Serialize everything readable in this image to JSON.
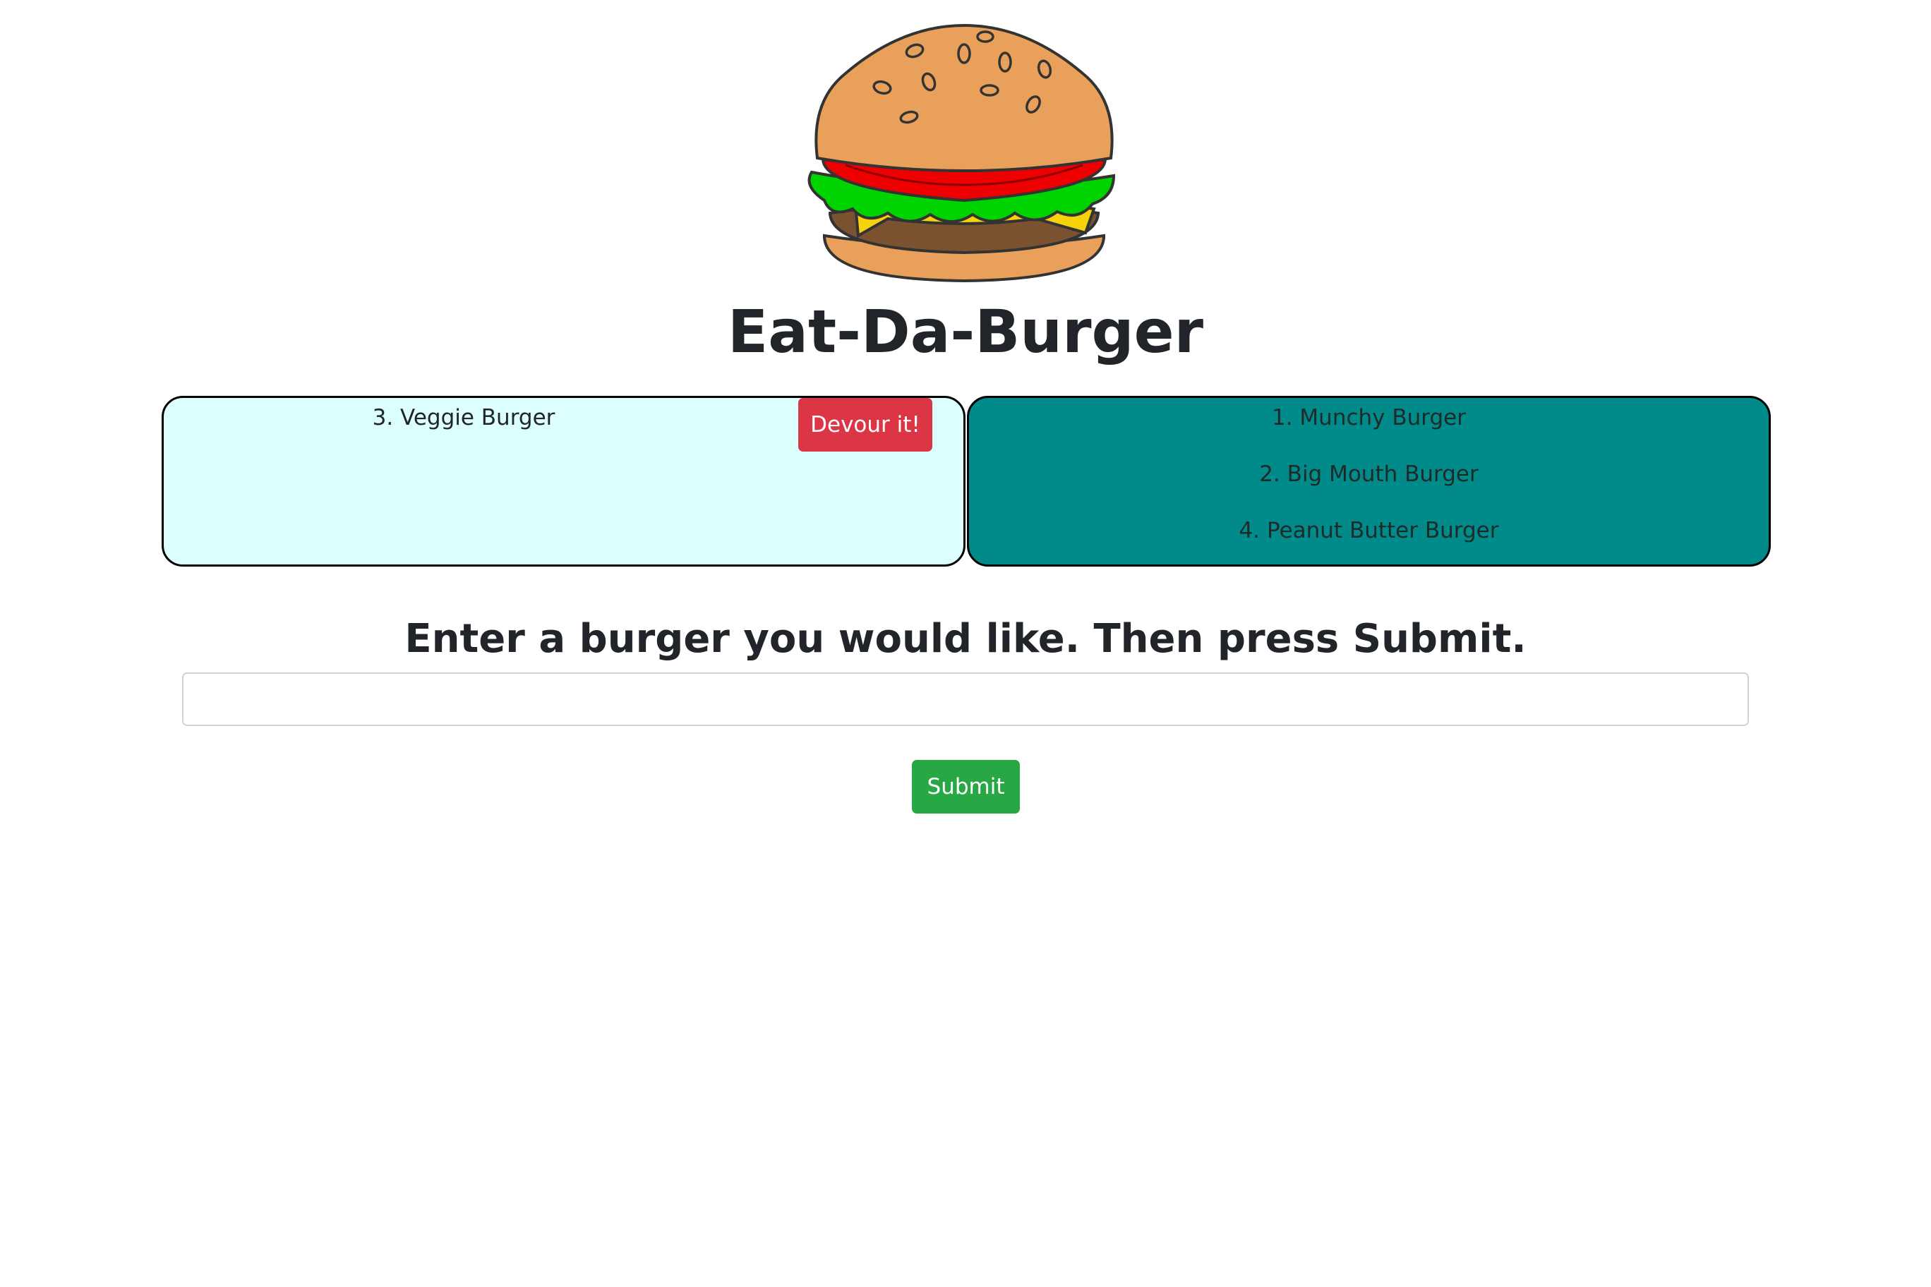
{
  "header": {
    "logo_icon": "hamburger-icon",
    "title": "Eat-Da-Burger"
  },
  "undevoured": {
    "items": [
      {
        "label": "3. Veggie Burger",
        "button_label": "Devour it!"
      }
    ],
    "background": "#dcfffe"
  },
  "devoured": {
    "items": [
      {
        "label": "1. Munchy Burger"
      },
      {
        "label": "2. Big Mouth Burger"
      },
      {
        "label": "4. Peanut Butter Burger"
      }
    ],
    "background": "#008b8a"
  },
  "form": {
    "prompt": "Enter a burger you would like. Then press Submit.",
    "input_value": "",
    "input_placeholder": "",
    "submit_label": "Submit"
  },
  "colors": {
    "devour_button": "#dc3545",
    "submit_button": "#28a745"
  }
}
